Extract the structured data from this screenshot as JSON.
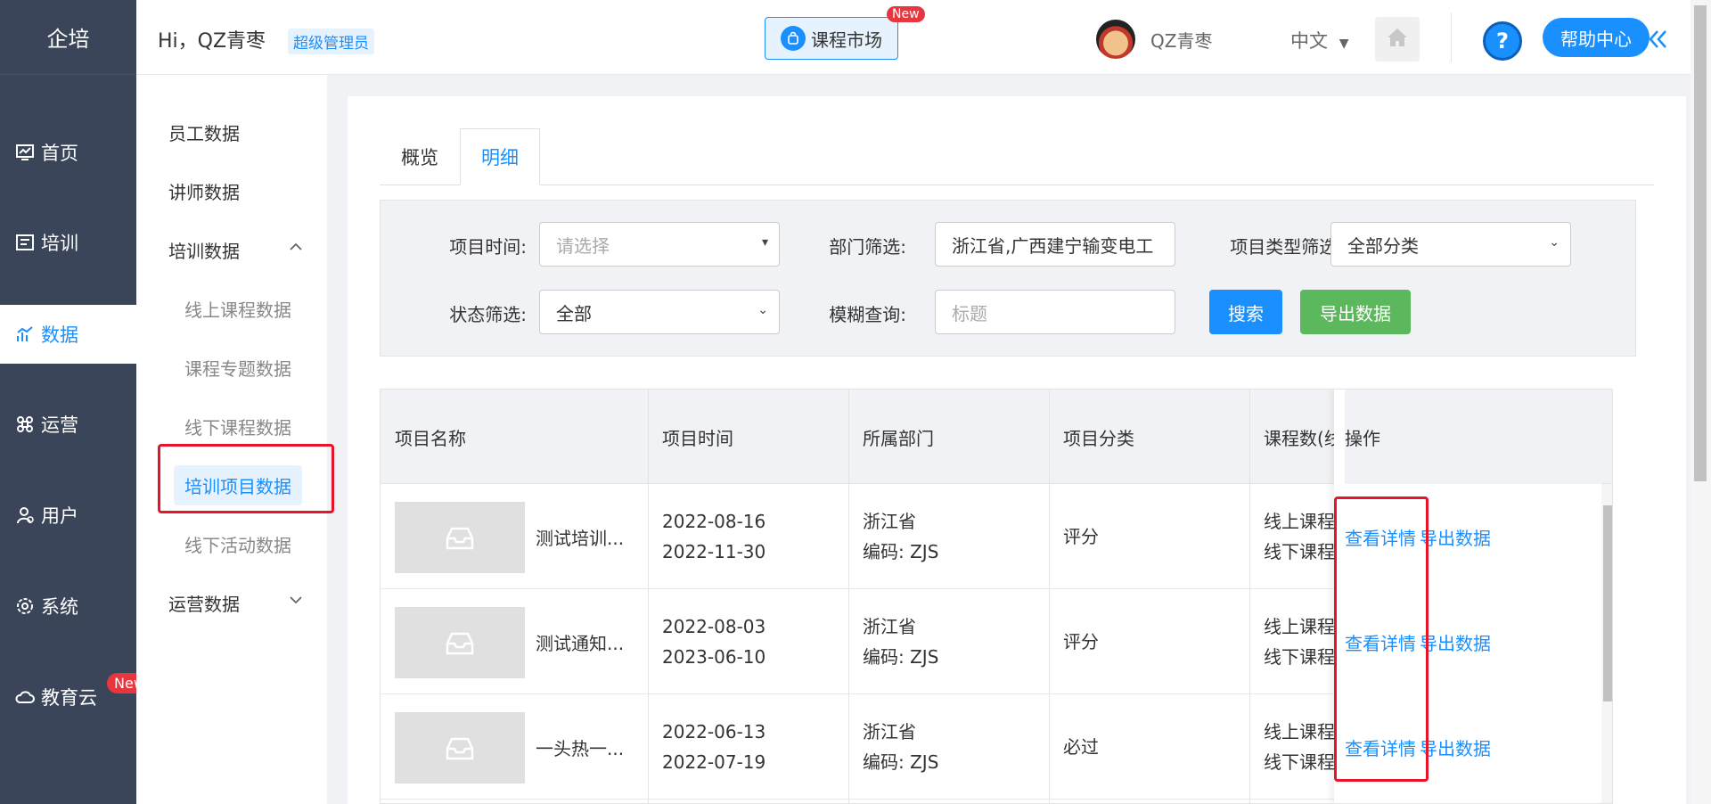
{
  "nav": {
    "brand": "企培",
    "items": [
      {
        "label": "首页",
        "icon": "dashboard-icon"
      },
      {
        "label": "培训",
        "icon": "training-icon"
      },
      {
        "label": "数据",
        "icon": "chart-icon",
        "active": true
      },
      {
        "label": "运营",
        "icon": "command-icon"
      },
      {
        "label": "用户",
        "icon": "user-icon"
      },
      {
        "label": "系统",
        "icon": "gear-icon"
      },
      {
        "label": "教育云",
        "icon": "cloud-icon"
      }
    ],
    "cloud_badge": "New"
  },
  "header": {
    "greeting": "Hi，QZ青枣",
    "role": "超级管理员",
    "market_label": "课程市场",
    "market_badge": "New",
    "username": "QZ青枣",
    "language": "中文",
    "help_label": "帮助中心",
    "help_symbol": "?"
  },
  "submenu": {
    "items": [
      {
        "label": "员工数据"
      },
      {
        "label": "讲师数据"
      },
      {
        "label": "培训数据"
      },
      {
        "label": "线上课程数据"
      },
      {
        "label": "课程专题数据"
      },
      {
        "label": "线下课程数据"
      },
      {
        "label": "培训项目数据",
        "active": true
      },
      {
        "label": "线下活动数据"
      },
      {
        "label": "运营数据"
      }
    ]
  },
  "tabs": [
    {
      "label": "概览"
    },
    {
      "label": "明细",
      "active": true
    }
  ],
  "filters": {
    "time_label": "项目时间:",
    "time_placeholder": "请选择",
    "dept_label": "部门筛选:",
    "dept_value": "浙江省,广西建宁输变电工",
    "type_label": "项目类型筛选:",
    "type_value": "全部分类",
    "status_label": "状态筛选:",
    "status_value": "全部",
    "query_label": "模糊查询:",
    "query_placeholder": "标题",
    "search_label": "搜索",
    "export_label": "导出数据"
  },
  "table": {
    "headers": [
      "项目名称",
      "项目时间",
      "所属部门",
      "项目分类",
      "课程数(线",
      "操作"
    ],
    "rows": [
      {
        "name": "测试培训...",
        "start": "2022-08-16",
        "end": "2022-11-30",
        "dept": "浙江省",
        "code": "编码:  ZJS",
        "category": "评分",
        "online": "线上课程:",
        "offline": "线下课程:",
        "view": "查看详情",
        "export": "导出数据"
      },
      {
        "name": "测试通知...",
        "start": "2022-08-03",
        "end": "2023-06-10",
        "dept": "浙江省",
        "code": "编码:  ZJS",
        "category": "评分",
        "online": "线上课程:",
        "offline": "线下课程:",
        "view": "查看详情",
        "export": "导出数据"
      },
      {
        "name": "一头热一...",
        "start": "2022-06-13",
        "end": "2022-07-19",
        "dept": "浙江省",
        "code": "编码:  ZJS",
        "category": "必过",
        "online": "线上课程:",
        "offline": "线下课程:",
        "view": "查看详情",
        "export": "导出数据"
      }
    ]
  },
  "colors": {
    "nav_bg": "#3a4559",
    "accent": "#1a8ffe",
    "export_green": "#5cb85c",
    "highlight_red": "#e8142a",
    "badge_red": "#e8363f"
  }
}
